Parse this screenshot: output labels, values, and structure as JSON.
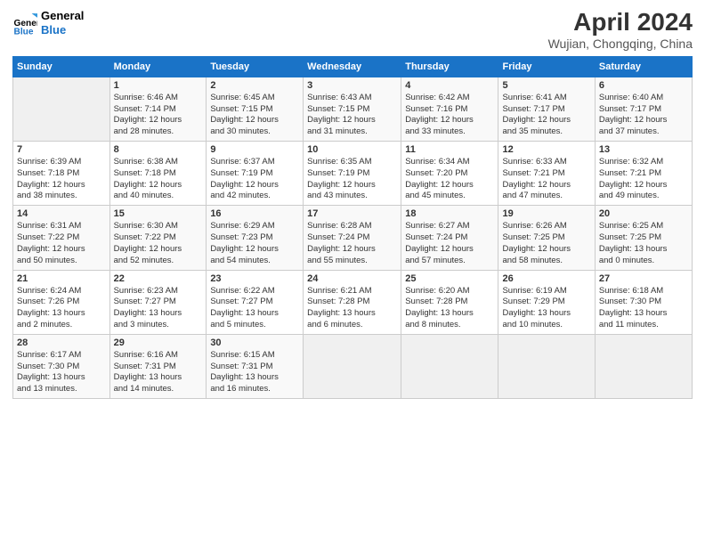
{
  "header": {
    "title": "April 2024",
    "subtitle": "Wujian, Chongqing, China"
  },
  "columns": [
    "Sunday",
    "Monday",
    "Tuesday",
    "Wednesday",
    "Thursday",
    "Friday",
    "Saturday"
  ],
  "weeks": [
    [
      {
        "num": "",
        "info": ""
      },
      {
        "num": "1",
        "info": "Sunrise: 6:46 AM\nSunset: 7:14 PM\nDaylight: 12 hours\nand 28 minutes."
      },
      {
        "num": "2",
        "info": "Sunrise: 6:45 AM\nSunset: 7:15 PM\nDaylight: 12 hours\nand 30 minutes."
      },
      {
        "num": "3",
        "info": "Sunrise: 6:43 AM\nSunset: 7:15 PM\nDaylight: 12 hours\nand 31 minutes."
      },
      {
        "num": "4",
        "info": "Sunrise: 6:42 AM\nSunset: 7:16 PM\nDaylight: 12 hours\nand 33 minutes."
      },
      {
        "num": "5",
        "info": "Sunrise: 6:41 AM\nSunset: 7:17 PM\nDaylight: 12 hours\nand 35 minutes."
      },
      {
        "num": "6",
        "info": "Sunrise: 6:40 AM\nSunset: 7:17 PM\nDaylight: 12 hours\nand 37 minutes."
      }
    ],
    [
      {
        "num": "7",
        "info": "Sunrise: 6:39 AM\nSunset: 7:18 PM\nDaylight: 12 hours\nand 38 minutes."
      },
      {
        "num": "8",
        "info": "Sunrise: 6:38 AM\nSunset: 7:18 PM\nDaylight: 12 hours\nand 40 minutes."
      },
      {
        "num": "9",
        "info": "Sunrise: 6:37 AM\nSunset: 7:19 PM\nDaylight: 12 hours\nand 42 minutes."
      },
      {
        "num": "10",
        "info": "Sunrise: 6:35 AM\nSunset: 7:19 PM\nDaylight: 12 hours\nand 43 minutes."
      },
      {
        "num": "11",
        "info": "Sunrise: 6:34 AM\nSunset: 7:20 PM\nDaylight: 12 hours\nand 45 minutes."
      },
      {
        "num": "12",
        "info": "Sunrise: 6:33 AM\nSunset: 7:21 PM\nDaylight: 12 hours\nand 47 minutes."
      },
      {
        "num": "13",
        "info": "Sunrise: 6:32 AM\nSunset: 7:21 PM\nDaylight: 12 hours\nand 49 minutes."
      }
    ],
    [
      {
        "num": "14",
        "info": "Sunrise: 6:31 AM\nSunset: 7:22 PM\nDaylight: 12 hours\nand 50 minutes."
      },
      {
        "num": "15",
        "info": "Sunrise: 6:30 AM\nSunset: 7:22 PM\nDaylight: 12 hours\nand 52 minutes."
      },
      {
        "num": "16",
        "info": "Sunrise: 6:29 AM\nSunset: 7:23 PM\nDaylight: 12 hours\nand 54 minutes."
      },
      {
        "num": "17",
        "info": "Sunrise: 6:28 AM\nSunset: 7:24 PM\nDaylight: 12 hours\nand 55 minutes."
      },
      {
        "num": "18",
        "info": "Sunrise: 6:27 AM\nSunset: 7:24 PM\nDaylight: 12 hours\nand 57 minutes."
      },
      {
        "num": "19",
        "info": "Sunrise: 6:26 AM\nSunset: 7:25 PM\nDaylight: 12 hours\nand 58 minutes."
      },
      {
        "num": "20",
        "info": "Sunrise: 6:25 AM\nSunset: 7:25 PM\nDaylight: 13 hours\nand 0 minutes."
      }
    ],
    [
      {
        "num": "21",
        "info": "Sunrise: 6:24 AM\nSunset: 7:26 PM\nDaylight: 13 hours\nand 2 minutes."
      },
      {
        "num": "22",
        "info": "Sunrise: 6:23 AM\nSunset: 7:27 PM\nDaylight: 13 hours\nand 3 minutes."
      },
      {
        "num": "23",
        "info": "Sunrise: 6:22 AM\nSunset: 7:27 PM\nDaylight: 13 hours\nand 5 minutes."
      },
      {
        "num": "24",
        "info": "Sunrise: 6:21 AM\nSunset: 7:28 PM\nDaylight: 13 hours\nand 6 minutes."
      },
      {
        "num": "25",
        "info": "Sunrise: 6:20 AM\nSunset: 7:28 PM\nDaylight: 13 hours\nand 8 minutes."
      },
      {
        "num": "26",
        "info": "Sunrise: 6:19 AM\nSunset: 7:29 PM\nDaylight: 13 hours\nand 10 minutes."
      },
      {
        "num": "27",
        "info": "Sunrise: 6:18 AM\nSunset: 7:30 PM\nDaylight: 13 hours\nand 11 minutes."
      }
    ],
    [
      {
        "num": "28",
        "info": "Sunrise: 6:17 AM\nSunset: 7:30 PM\nDaylight: 13 hours\nand 13 minutes."
      },
      {
        "num": "29",
        "info": "Sunrise: 6:16 AM\nSunset: 7:31 PM\nDaylight: 13 hours\nand 14 minutes."
      },
      {
        "num": "30",
        "info": "Sunrise: 6:15 AM\nSunset: 7:31 PM\nDaylight: 13 hours\nand 16 minutes."
      },
      {
        "num": "",
        "info": ""
      },
      {
        "num": "",
        "info": ""
      },
      {
        "num": "",
        "info": ""
      },
      {
        "num": "",
        "info": ""
      }
    ]
  ]
}
